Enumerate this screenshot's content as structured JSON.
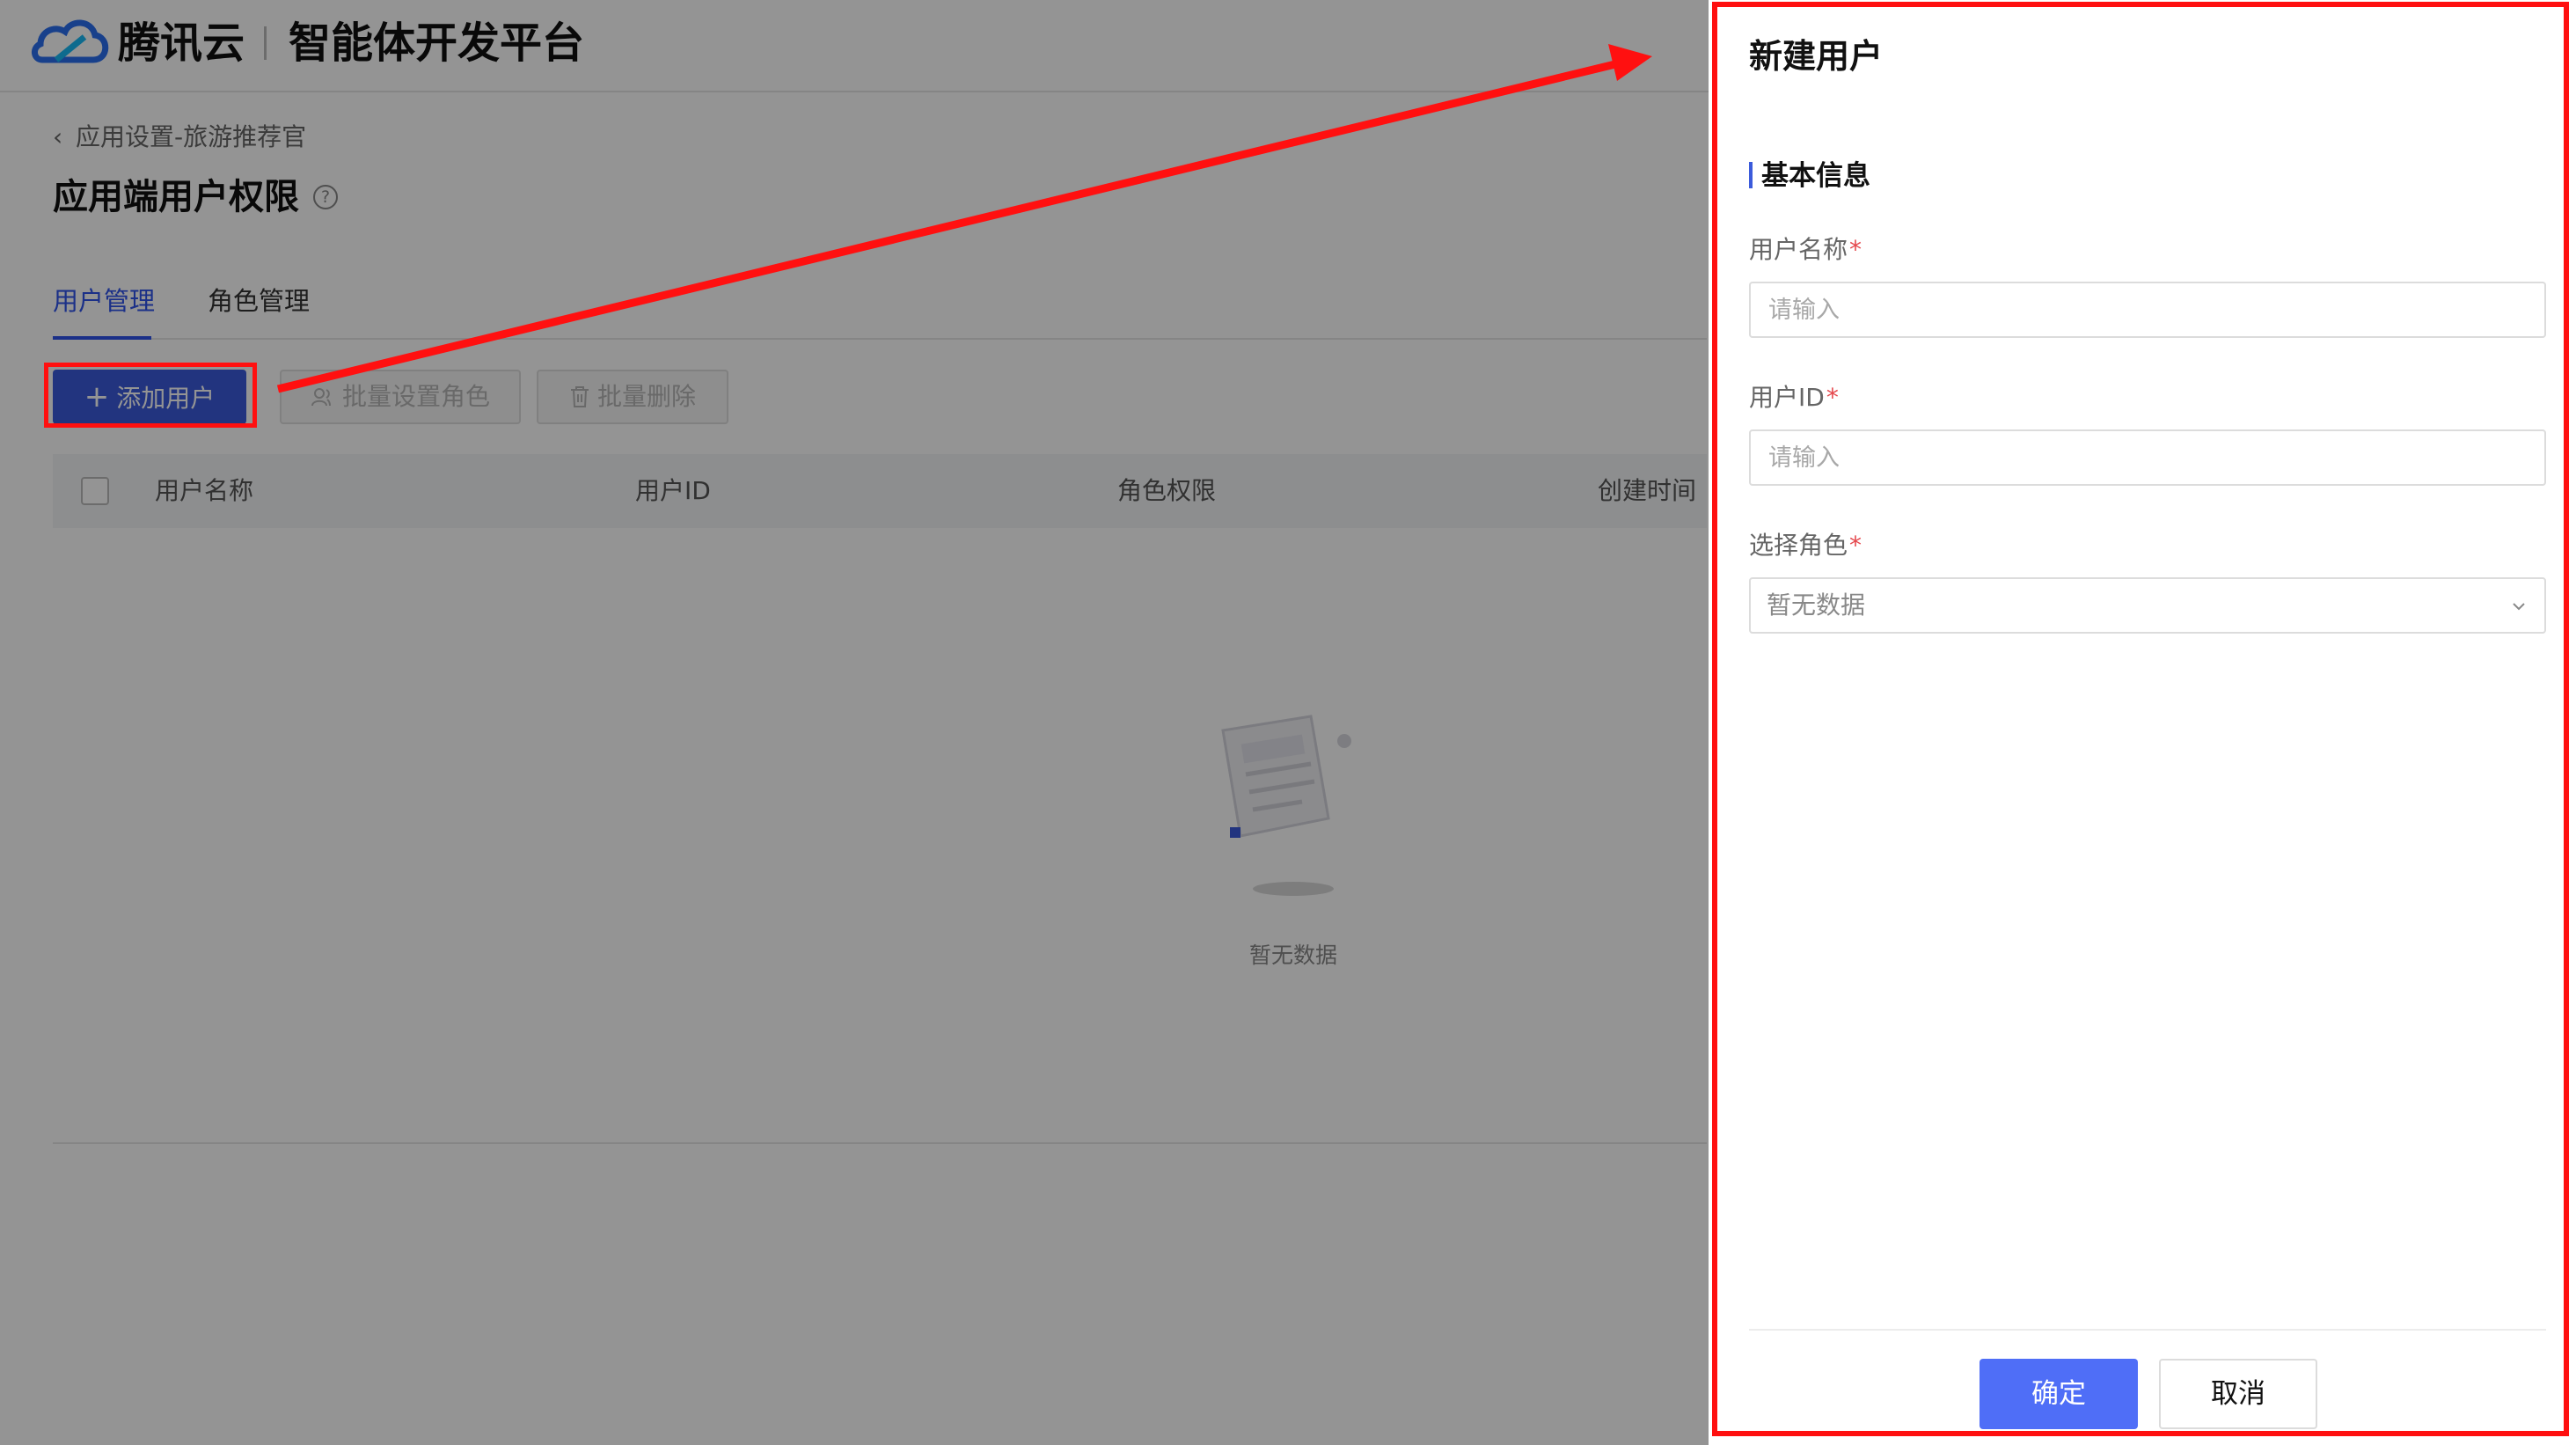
{
  "header": {
    "brand": "腾讯云",
    "platform": "智能体开发平台"
  },
  "breadcrumb": {
    "back_icon": "chevron-left-icon",
    "text": "应用设置-旅游推荐官"
  },
  "page": {
    "title": "应用端用户权限",
    "help_icon": "question-circle-icon"
  },
  "tabs": [
    {
      "label": "用户管理",
      "active": true
    },
    {
      "label": "角色管理",
      "active": false
    }
  ],
  "toolbar": {
    "add_user": "添加用户",
    "batch_set_role": "批量设置角色",
    "batch_delete": "批量删除"
  },
  "table": {
    "columns": [
      "用户名称",
      "用户ID",
      "角色权限",
      "创建时间"
    ],
    "empty_text": "暂无数据"
  },
  "drawer": {
    "title": "新建用户",
    "section_title": "基本信息",
    "fields": {
      "username": {
        "label": "用户名称",
        "required_mark": "*",
        "placeholder": "请输入",
        "value": ""
      },
      "user_id": {
        "label": "用户ID",
        "required_mark": "*",
        "placeholder": "请输入",
        "value": ""
      },
      "role": {
        "label": "选择角色",
        "required_mark": "*",
        "value": "暂无数据"
      }
    },
    "confirm": "确定",
    "cancel": "取消"
  },
  "colors": {
    "primary": "#3b5bdb",
    "confirm_button": "#4f6ef7",
    "annotation_red": "#ff1010"
  }
}
